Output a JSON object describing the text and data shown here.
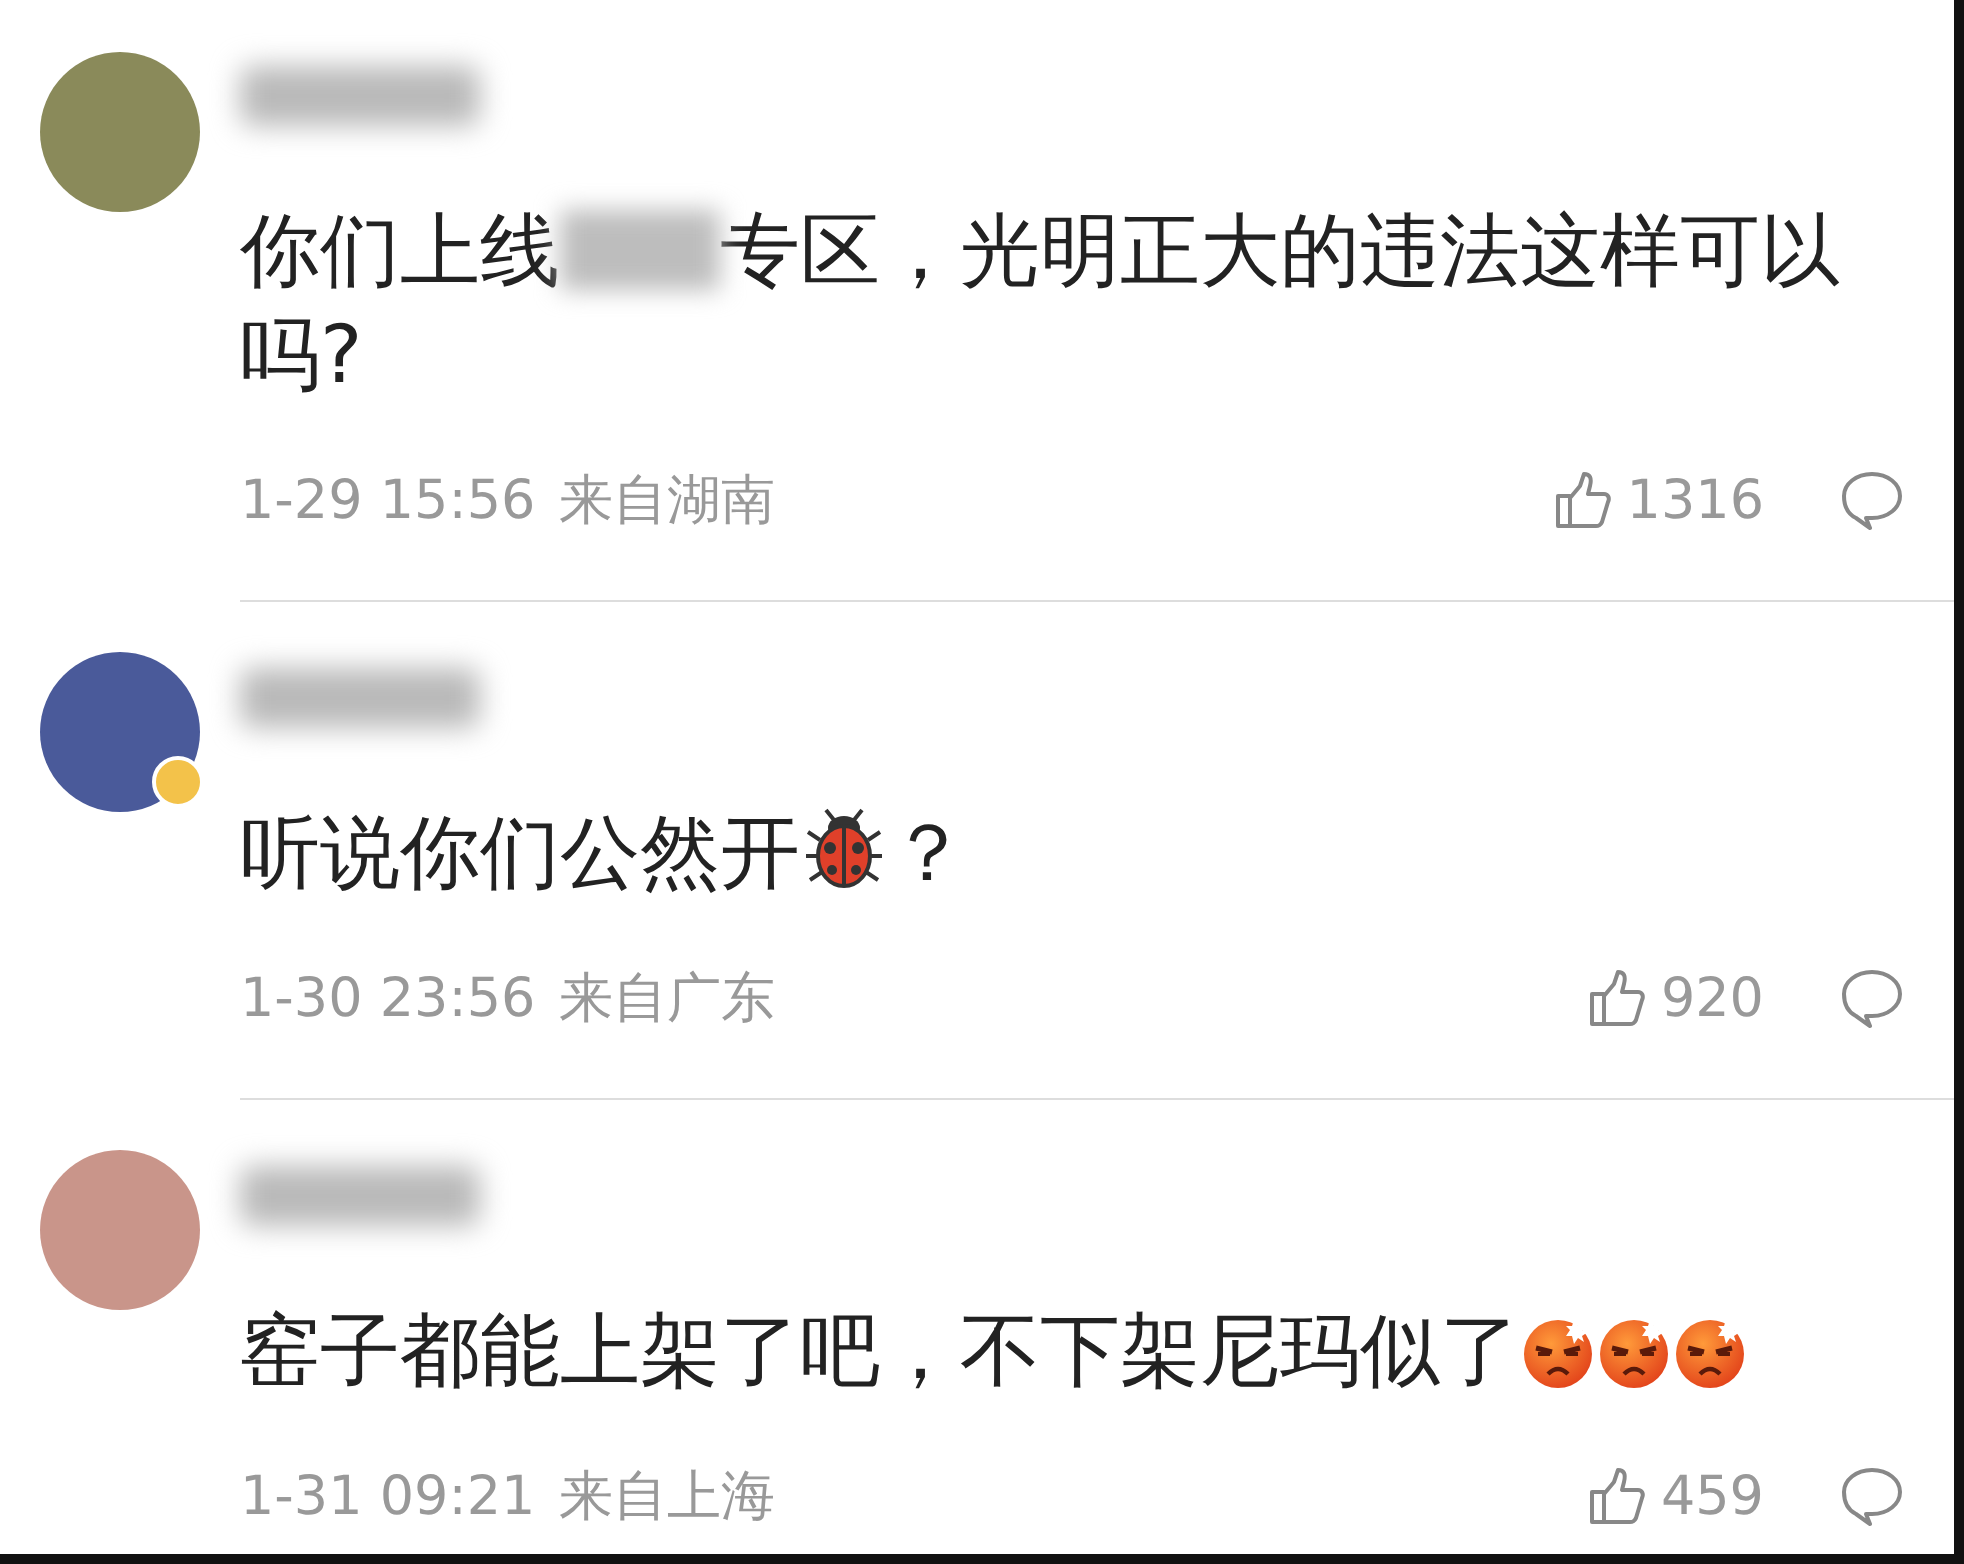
{
  "comments": [
    {
      "color": "#8a8a5a",
      "badge": false,
      "content": [
        {
          "kind": "text",
          "text": "你们上线"
        },
        {
          "kind": "redacted"
        },
        {
          "kind": "text",
          "text": "专区，光明正大的违法这样可以吗?"
        }
      ],
      "time": "1-29 15:56",
      "location": "来自湖南",
      "likes": "1316"
    },
    {
      "color": "#4a5a9a",
      "badge": true,
      "content": [
        {
          "kind": "text",
          "text": "听说你们公然开"
        },
        {
          "kind": "ladybug"
        },
        {
          "kind": "text",
          "text": "？"
        }
      ],
      "time": "1-30 23:56",
      "location": "来自广东",
      "likes": "920"
    },
    {
      "color": "#c9958a",
      "badge": false,
      "content": [
        {
          "kind": "text",
          "text": "窑子都能上架了吧，不下架尼玛似了"
        },
        {
          "kind": "angry"
        },
        {
          "kind": "angry"
        },
        {
          "kind": "angry"
        }
      ],
      "time": "1-31 09:21",
      "location": "来自上海",
      "likes": "459"
    }
  ]
}
